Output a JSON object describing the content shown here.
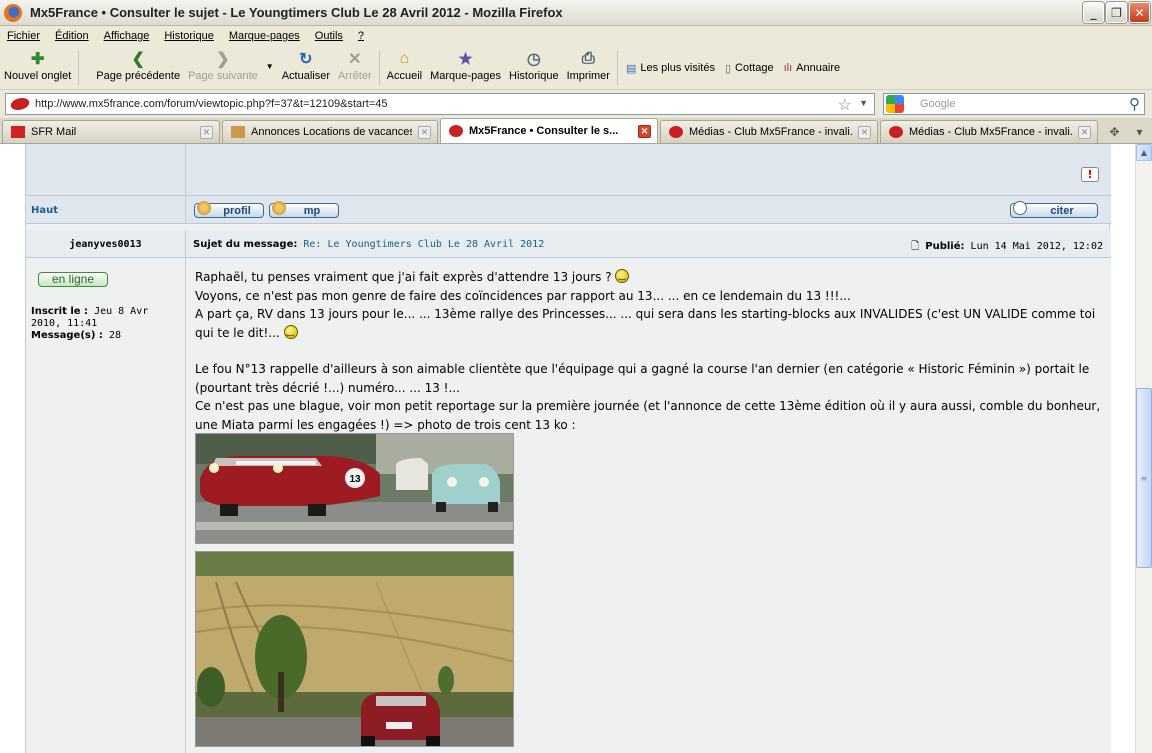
{
  "window": {
    "title": "Mx5France • Consulter le sujet - Le Youngtimers Club Le 28 Avril 2012 - Mozilla Firefox"
  },
  "menu": [
    "Fichier",
    "Édition",
    "Affichage",
    "Historique",
    "Marque-pages",
    "Outils",
    "?"
  ],
  "toolbar": {
    "new_tab": "Nouvel onglet",
    "back": "Page précédente",
    "forward": "Page suivante",
    "reload": "Actualiser",
    "stop": "Arrêter",
    "home": "Accueil",
    "bookmarks": "Marque-pages",
    "history": "Historique",
    "print": "Imprimer"
  },
  "bookmarks_bar": [
    "Les plus visités",
    "Cottage",
    "Annuaire"
  ],
  "address": {
    "url": "http://www.mx5france.com/forum/viewtopic.php?f=37&t=12109&start=45"
  },
  "search": {
    "placeholder": "Google"
  },
  "tabs": [
    {
      "label": "SFR Mail",
      "active": false
    },
    {
      "label": "Annonces Locations de vacances...",
      "active": false
    },
    {
      "label": "Mx5France • Consulter le s...",
      "active": true
    },
    {
      "label": "Médias - Club Mx5France - invali...",
      "active": false
    },
    {
      "label": "Médias - Club Mx5France - invali...",
      "active": false
    }
  ],
  "forum": {
    "top_link": "Haut",
    "buttons": {
      "profile": "profil",
      "pm": "mp",
      "quote": "citer"
    },
    "post": {
      "author": "jeanyves0013",
      "subject_label": "Sujet du message:",
      "subject": "Re: Le Youngtimers Club Le 28 Avril 2012",
      "posted_label": "Publié:",
      "posted": "Lun 14 Mai 2012, 12:02",
      "online": "en ligne",
      "joined_label": "Inscrit le :",
      "joined": "Jeu 8 Avr 2010, 11:41",
      "messages_label": "Message(s) :",
      "messages": "28",
      "body": {
        "line1": "Raphaël, tu penses vraiment que j'ai fait exprès d'attendre 13 jours ?",
        "line2": "Voyons, ce n'est pas mon genre de faire des coïncidences par rapport au 13... ... en ce lendemain du 13 !!!...",
        "line3": "A part ça, RV dans 13 jours pour le... ... 13ème rallye des Princesses... ... qui sera dans les starting-blocks aux INVALIDES (c'est UN VALIDE comme toi qui te le dit!...",
        "line4": "Le fou N°13 rappelle d'ailleurs à son aimable clientète que l'équipage qui a gagné la course l'an dernier (en catégorie « Historic Féminin ») portait le (pourtant très décrié !...) numéro... ... 13 !...",
        "line5": "Ce n'est pas une blague, voir mon petit reportage sur la première journée (et l'annonce de cette 13ème édition où il y aura aussi, comble du bonheur, une Miata parmi les engagées !) => photo de trois cent 13 ko :"
      },
      "photo1_number": "13"
    }
  }
}
